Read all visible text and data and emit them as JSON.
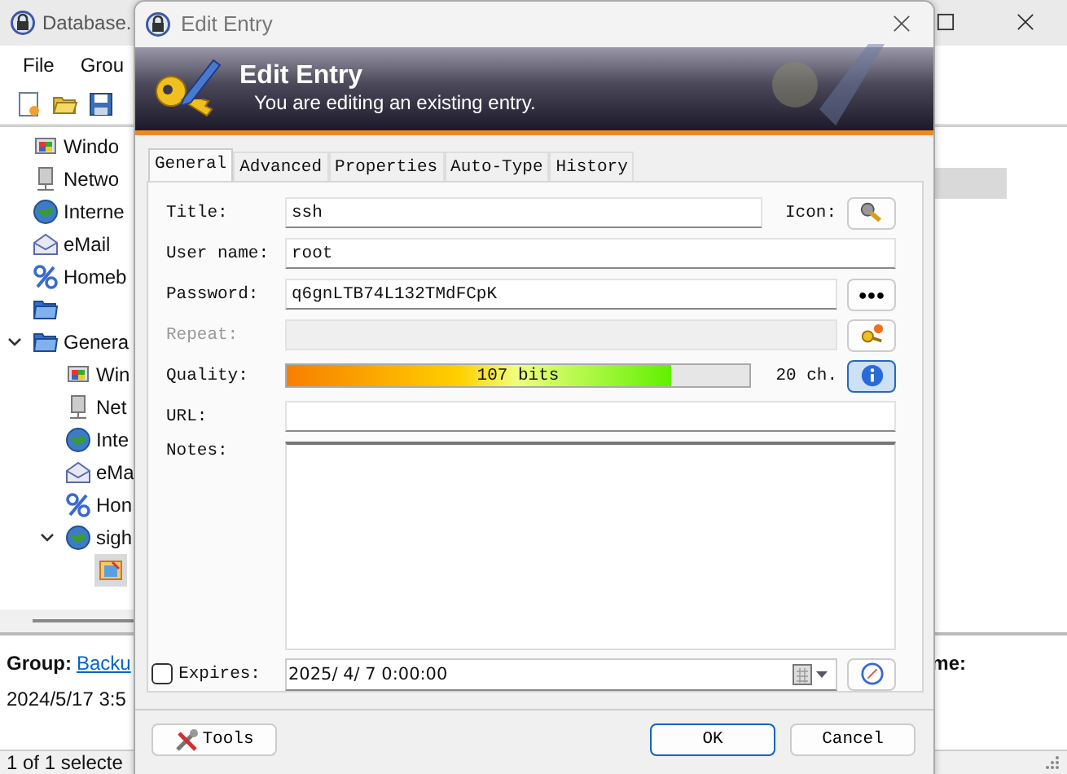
{
  "background_window": {
    "title": "Database.",
    "menu": [
      "File",
      "Grou"
    ],
    "tree": [
      {
        "label": "Windo",
        "kind": "windows",
        "selected": false
      },
      {
        "label": "Netwo",
        "kind": "network",
        "selected": false
      },
      {
        "label": "Interne",
        "kind": "internet",
        "selected": false
      },
      {
        "label": "eMail",
        "kind": "email",
        "selected": false
      },
      {
        "label": "Homeb",
        "kind": "percent",
        "selected": false
      },
      {
        "kind": "folder",
        "selected": false
      },
      {
        "label": "Genera",
        "kind": "folder",
        "selected": false,
        "expanded": true,
        "children": [
          {
            "label": "Win",
            "kind": "windows",
            "selected": false
          },
          {
            "label": "Net",
            "kind": "network",
            "selected": false
          },
          {
            "label": "Inte",
            "kind": "internet",
            "selected": false
          },
          {
            "label": "eMa",
            "kind": "email",
            "selected": false
          },
          {
            "label": "Hon",
            "kind": "percent",
            "selected": false
          },
          {
            "label": "sigh",
            "kind": "internet",
            "selected": false,
            "expanded": true,
            "children": [
              {
                "kind": "entry",
                "selected": true
              }
            ]
          }
        ]
      }
    ],
    "entry_list": {
      "rows": [
        {
          "selected": true
        }
      ]
    },
    "details": {
      "group_label": "Group:",
      "group_link": "Backu",
      "date": "2024/5/17 3:5",
      "field_label": "me:"
    },
    "status_bar": "1 of 1 selecte"
  },
  "dialog": {
    "title": "Edit Entry",
    "banner": {
      "title": "Edit Entry",
      "subtitle": "You are editing an existing entry."
    },
    "tabs": [
      {
        "label": "General",
        "selected": true
      },
      {
        "label": "Advanced",
        "selected": false
      },
      {
        "label": "Properties",
        "selected": false
      },
      {
        "label": "Auto-Type",
        "selected": false
      },
      {
        "label": "History",
        "selected": false
      }
    ],
    "title_field": {
      "label": "Title:",
      "value": "ssh"
    },
    "icon_label": "Icon:",
    "username": {
      "label": "User name:",
      "value": "root"
    },
    "password": {
      "label": "Password:",
      "value": "q6gnLTB74L132TMdFCpK",
      "reveal_button": "●●●"
    },
    "repeat": {
      "label": "Repeat:",
      "disabled": true
    },
    "quality": {
      "label": "Quality:",
      "level": 0.83,
      "reading": "107 bits",
      "length": "20 ch."
    },
    "url": {
      "label": "URL:"
    },
    "notes": {
      "label": "Notes:"
    },
    "expires": {
      "label": "Expires:",
      "checked": false,
      "value": "2025/ 4/ 7  0:00:00"
    },
    "buttons": {
      "tools": "Tools",
      "ok": "OK",
      "cancel": "Cancel"
    }
  }
}
